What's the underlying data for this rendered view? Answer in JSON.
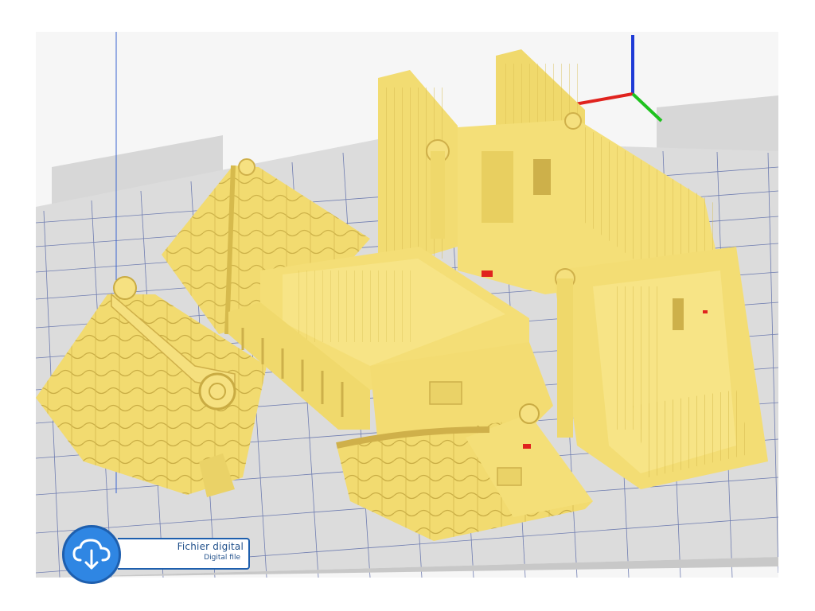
{
  "viewer": {
    "background": "#ffffff",
    "sky_color": "#f5f5f5",
    "bed_color": "#dcdcdc",
    "bed_grid_color": "#5f6ea8",
    "model_color": "#f3dd73",
    "model_shade": "#d9bf4f",
    "axes": {
      "x_color": "#e0231e",
      "y_color": "#1fc21f",
      "z_color": "#1f3bd6"
    }
  },
  "model": {
    "name_icon": "japanese-castle-model",
    "parts": [
      "left-roof-piece",
      "back-roof-piece",
      "central-room",
      "rear-wall-block",
      "right-room",
      "front-roof-piece"
    ]
  },
  "badge": {
    "title": "Fichier digital",
    "subtitle": "Digital file",
    "icon": "cloud-download-icon",
    "color": "#2f86e3"
  }
}
